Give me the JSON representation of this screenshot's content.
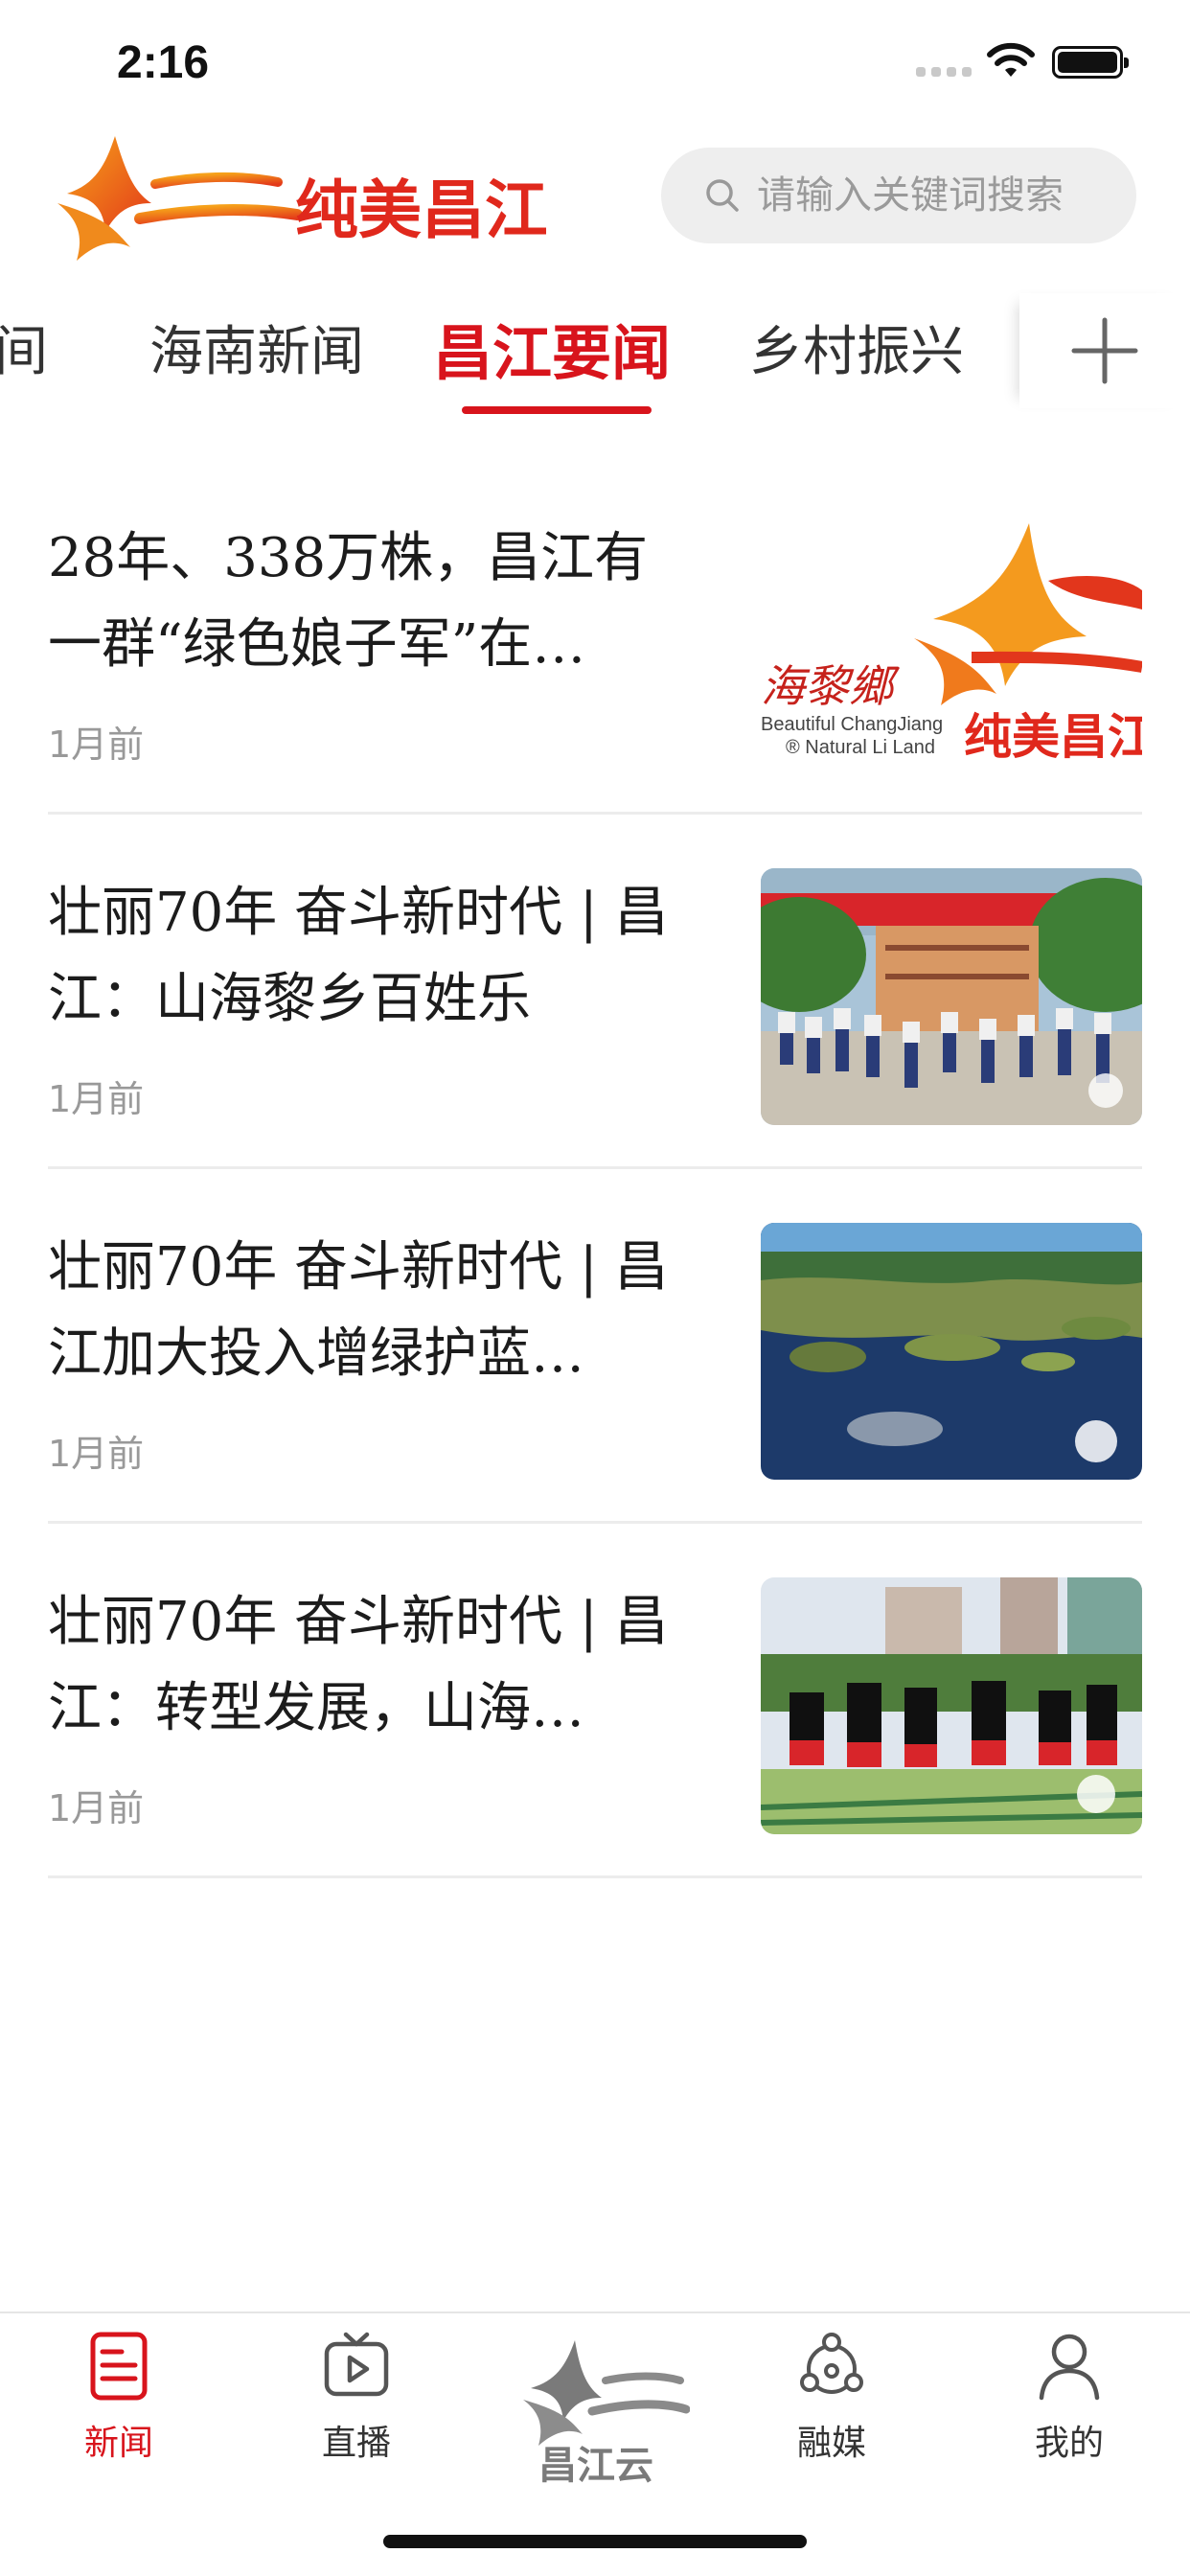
{
  "status_bar": {
    "time": "2:16"
  },
  "header": {
    "logo_text": "纯美昌江",
    "search_placeholder": "请输入关键词搜索"
  },
  "channels": {
    "tabs": [
      {
        "label": "时间"
      },
      {
        "label": "海南新闻"
      },
      {
        "label": "昌江要闻"
      },
      {
        "label": "乡村振兴"
      }
    ],
    "active_index": 2,
    "partial_first_label": "间"
  },
  "news": [
    {
      "title": "28年、338万株，昌江有一群“绿色娘子军”在…",
      "time": "1月前",
      "thumb": "logo-banner",
      "thumb_text": {
        "left": "海黎鄉",
        "en1": "Beautiful ChangJiang",
        "en2": "® Natural Li Land",
        "right": "纯美昌江"
      }
    },
    {
      "title": "壮丽70年 奋斗新时代 | 昌江：山海黎乡百姓乐",
      "time": "1月前",
      "thumb": "students-photo"
    },
    {
      "title": "壮丽70年 奋斗新时代 | 昌江加大投入增绿护蓝…",
      "time": "1月前",
      "thumb": "wetland-photo"
    },
    {
      "title": "壮丽70年 奋斗新时代 | 昌江：转型发展，山海…",
      "time": "1月前",
      "thumb": "bamboo-dance-photo"
    }
  ],
  "tab_bar": {
    "items": [
      {
        "label": "新闻",
        "icon": "news-icon",
        "active": true
      },
      {
        "label": "直播",
        "icon": "play-icon",
        "active": false
      },
      {
        "label": "昌江云",
        "icon": "changjiang-cloud-logo",
        "active": false
      },
      {
        "label": "融媒",
        "icon": "media-hub-icon",
        "active": false
      },
      {
        "label": "我的",
        "icon": "user-icon",
        "active": false
      }
    ]
  },
  "colors": {
    "accent": "#d8141c",
    "muted_text": "#999999",
    "divider": "#ececec"
  }
}
